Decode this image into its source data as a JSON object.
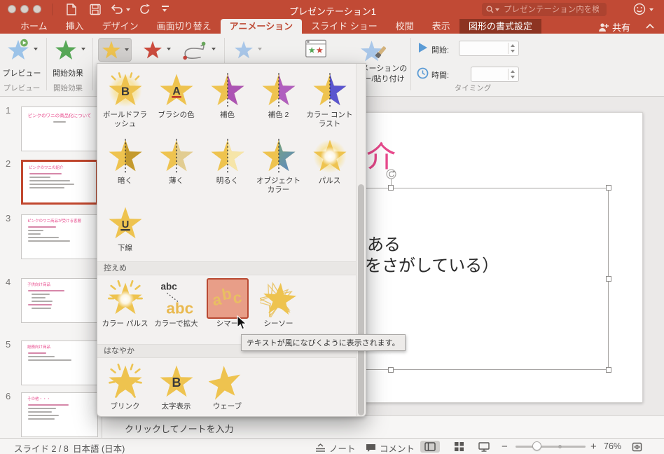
{
  "titlebar": {
    "title": "プレゼンテーション1",
    "search_placeholder": "プレゼンテーション内を検索"
  },
  "tabs": [
    "ホーム",
    "挿入",
    "デザイン",
    "画面切り替え",
    "アニメーション",
    "スライド ショー",
    "校閲",
    "表示",
    "図形の書式設定"
  ],
  "share_label": "共有",
  "ribbon": {
    "preview_label": "プレビュー",
    "preview_group": "プレビュー",
    "entrance_label": "開始効果",
    "entrance_group": "開始効果",
    "painter_label_line1": "アニメーションの",
    "painter_label_line2": "コピー/貼り付け",
    "start_label": "開始:",
    "duration_label": "時間:",
    "timing_group": "タイミング"
  },
  "dropdown": {
    "selected": "シマー",
    "tooltip": "テキストが風になびくように表示されます。",
    "sections": [
      {
        "header": "",
        "items": [
          "ボールドフラッシュ",
          "ブラシの色",
          "補色",
          "補色 2",
          "カラー コントラスト",
          "暗く",
          "薄く",
          "明るく",
          "オブジェクト カラー",
          "パルス",
          "下線"
        ]
      },
      {
        "header": "控えめ",
        "items": [
          "カラー パルス",
          "カラーで拡大",
          "シマー",
          "シーソー"
        ]
      },
      {
        "header": "はなやか",
        "items": [
          "ブリンク",
          "太字表示",
          "ウェーブ"
        ]
      }
    ]
  },
  "sidebar": {
    "slides": [
      {
        "num": "1",
        "title": "ピンクのワニの商品化について"
      },
      {
        "num": "2",
        "title": "ピンクのワニの紹介"
      },
      {
        "num": "3",
        "title": "ピンクのワニ商品が受ける客層"
      },
      {
        "num": "4",
        "title": "子供向け商品"
      },
      {
        "num": "5",
        "title": "総務向け商品"
      },
      {
        "num": "6",
        "title": "その他・・・"
      }
    ]
  },
  "canvas": {
    "slide_title": "ピンクのワニの紹介",
    "body_fragment_1": "ある",
    "body_fragment_2": "をさがしている）"
  },
  "notes": {
    "placeholder": "クリックしてノートを入力"
  },
  "statusbar": {
    "slide_counter": "スライド 2 / 8",
    "language": "日本語 (日本)",
    "notes_label": "ノート",
    "comments_label": "コメント",
    "zoom_out": "−",
    "zoom_in": "+",
    "zoom_level": "76%"
  },
  "colors": {
    "ribbon_red": "#C14A35",
    "contextual_tab": "#8D3422",
    "accent_gold": "#EEC34F",
    "selection_red": "#B94A33",
    "selected_tile_bg": "#E89E88",
    "slide_title_pink": "#E8498C"
  }
}
